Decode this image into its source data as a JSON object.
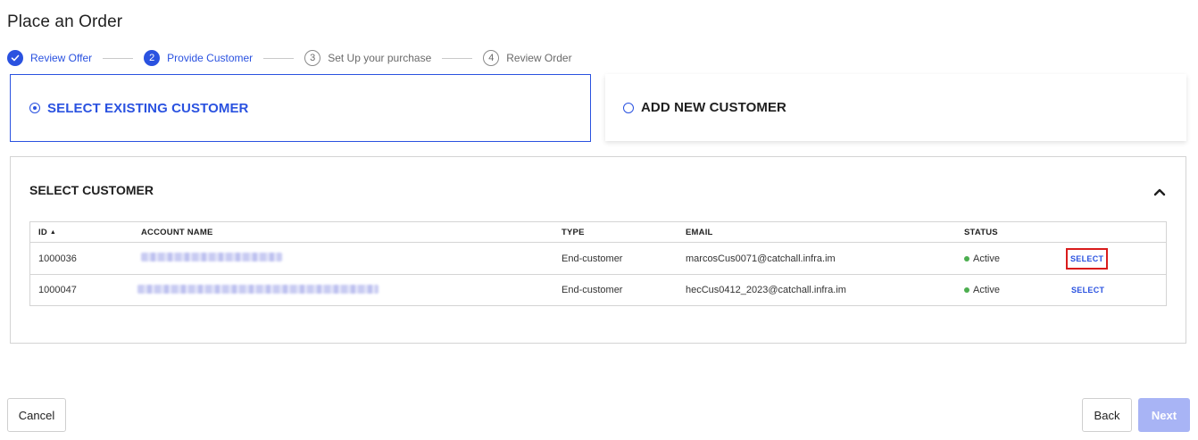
{
  "page": {
    "title": "Place an Order"
  },
  "stepper": {
    "steps": [
      {
        "number": "",
        "label": "Review Offer",
        "state": "done"
      },
      {
        "number": "2",
        "label": "Provide Customer",
        "state": "current"
      },
      {
        "number": "3",
        "label": "Set Up your purchase",
        "state": "todo"
      },
      {
        "number": "4",
        "label": "Review Order",
        "state": "todo"
      }
    ]
  },
  "options": {
    "existing": {
      "label": "SELECT EXISTING CUSTOMER",
      "selected": true
    },
    "new": {
      "label": "ADD NEW CUSTOMER",
      "selected": false
    }
  },
  "customer_panel": {
    "title": "SELECT CUSTOMER",
    "columns": {
      "id": "ID",
      "account_name": "ACCOUNT NAME",
      "type": "TYPE",
      "email": "EMAIL",
      "status": "STATUS"
    },
    "rows": [
      {
        "id": "1000036",
        "type": "End-customer",
        "email": "marcosCus0071@catchall.infra.im",
        "status": "Active",
        "action": "SELECT"
      },
      {
        "id": "1000047",
        "type": "End-customer",
        "email": "hecCus0412_2023@catchall.infra.im",
        "status": "Active",
        "action": "SELECT"
      }
    ]
  },
  "footer": {
    "cancel": "Cancel",
    "back": "Back",
    "next": "Next"
  },
  "colors": {
    "accent": "#2a52e0",
    "status_active": "#4cae4f",
    "next_disabled": "#a8b4f5",
    "highlight": "#d91c1c"
  }
}
